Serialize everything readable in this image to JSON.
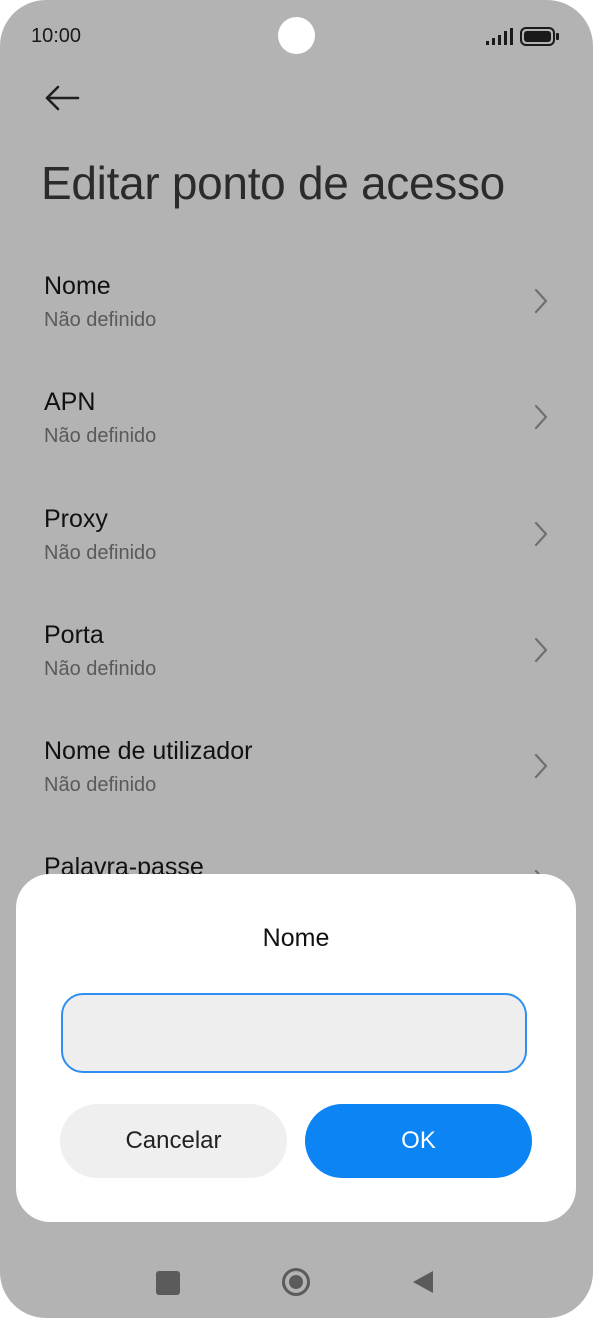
{
  "status_bar": {
    "time": "10:00"
  },
  "page": {
    "title": "Editar ponto de acesso"
  },
  "settings": [
    {
      "title": "Nome",
      "value": "Não definido"
    },
    {
      "title": "APN",
      "value": "Não definido"
    },
    {
      "title": "Proxy",
      "value": "Não definido"
    },
    {
      "title": "Porta",
      "value": "Não definido"
    },
    {
      "title": "Nome de utilizador",
      "value": "Não definido"
    },
    {
      "title": "Palavra-passe",
      "value": ""
    }
  ],
  "dialog": {
    "title": "Nome",
    "input_value": "",
    "cancel_label": "Cancelar",
    "ok_label": "OK"
  },
  "colors": {
    "accent": "#0c84f4",
    "input_border": "#2f8ff0",
    "scrim_background": "#b3b3b3"
  },
  "icons": {
    "back": "arrow-left-icon",
    "chevron": "chevron-right-icon",
    "signal": "signal-icon",
    "battery": "battery-icon",
    "nav_recent": "square-icon",
    "nav_home": "circle-icon",
    "nav_back": "triangle-icon"
  }
}
